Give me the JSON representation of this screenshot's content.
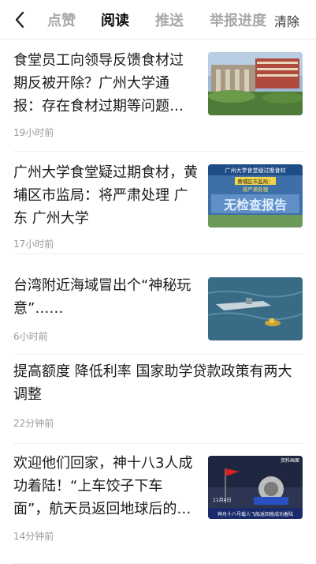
{
  "header": {
    "back_label": "<",
    "tabs": [
      {
        "label": "点赞"
      },
      {
        "label": "阅读"
      },
      {
        "label": "推送"
      },
      {
        "label": "举报进度"
      }
    ],
    "clear_label": "清除"
  },
  "items": [
    {
      "title": "食堂员工向领导反馈食材过期反被开除？广州大学通报：存在食材过期等问题…",
      "time": "19小时前"
    },
    {
      "title": "广州大学食堂疑过期食材，黄埔区市监局：将严肃处理 广东 广州大学",
      "time": "17小时前",
      "thumb_text": {
        "line1": "广州大学食堂疑过期食材",
        "line2": "黄埔区市监局：",
        "line3": "将严肃处理",
        "big": "无检查报告"
      }
    },
    {
      "title": "台湾附近海域冒出个“神秘玩意”……",
      "time": "6小时前"
    },
    {
      "title": "提高额度 降低利率 国家助学贷款政策有两大调整",
      "time": "22分钟前"
    },
    {
      "title": "欢迎他们回家，神十八3人成功着陆！“上车饺子下车面”，航天员返回地球后的…",
      "time": "14分钟前",
      "thumb_text": {
        "corner": "资料画面",
        "date": "11月4日",
        "banner": "神舟十八号载人飞船返回舱成功着陆"
      }
    }
  ]
}
